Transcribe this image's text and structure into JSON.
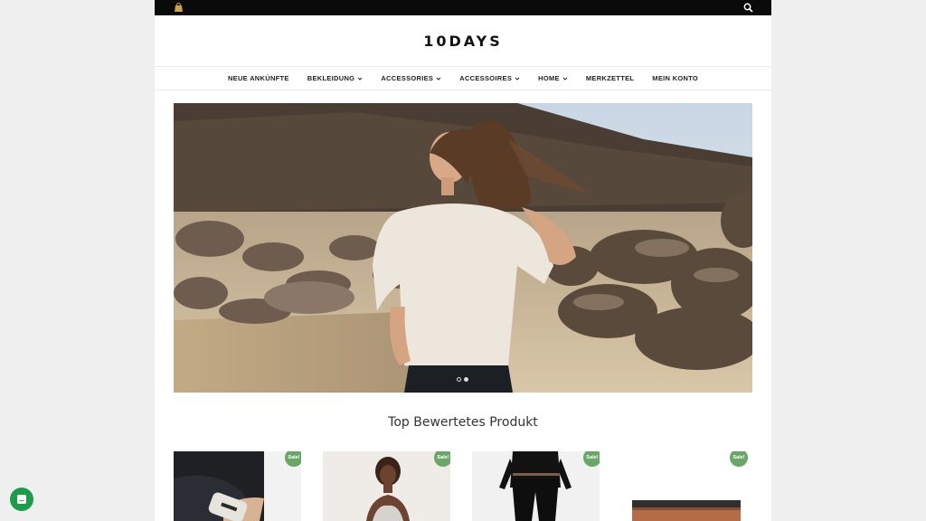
{
  "topbar": {
    "bag_icon": "shopping-bag-icon",
    "search_icon": "search-icon",
    "background": "#0a0a0a"
  },
  "brand": {
    "logo": "10DAYS"
  },
  "nav": {
    "items": [
      {
        "label": "NEUE ANKÜNFTE",
        "dropdown": false
      },
      {
        "label": "BEKLEIDUNG",
        "dropdown": true
      },
      {
        "label": "ACCESSORIES",
        "dropdown": true
      },
      {
        "label": "ACCESSOIRES",
        "dropdown": true
      },
      {
        "label": "HOME",
        "dropdown": true
      },
      {
        "label": "MERKZETTEL",
        "dropdown": false
      },
      {
        "label": "MEIN KONTO",
        "dropdown": false
      }
    ]
  },
  "hero": {
    "slide_count": 2,
    "active_slide": 2
  },
  "section": {
    "title": "Top Bewertetes Produkt"
  },
  "products": [
    {
      "badge": "Sale!"
    },
    {
      "badge": "Sale!"
    },
    {
      "badge": "Sale!"
    },
    {
      "badge": "Sale!"
    }
  ],
  "colors": {
    "sale_badge": "#6aa766",
    "chat_button": "#1c9b4b"
  },
  "chat": {
    "icon": "chat-icon"
  }
}
